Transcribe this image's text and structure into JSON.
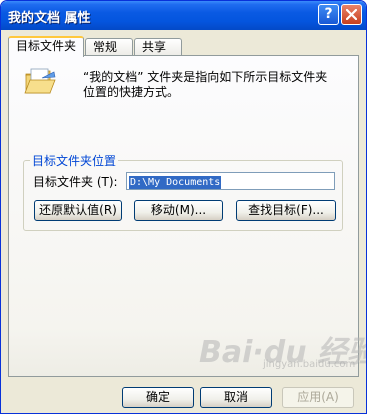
{
  "window": {
    "title": "我的文档  属性",
    "help_label": "?",
    "close_label": "×"
  },
  "tabs": [
    {
      "label": "目标文件夹"
    },
    {
      "label": "常规"
    },
    {
      "label": "共享"
    }
  ],
  "target_tab": {
    "description": "“我的文档” 文件夹是指向如下所示目标文件夹位置的快捷方式。",
    "group_title": "目标文件夹位置",
    "field_label": "目标文件夹 (T):",
    "field_value": "D:\\My Documents",
    "restore_button": "还原默认值(R)",
    "move_button": "移动(M)...",
    "find_button": "查找目标(F)..."
  },
  "footer": {
    "ok_button": "确定",
    "cancel_button": "取消",
    "apply_button": "应用(A)"
  },
  "watermark": {
    "text": "Bai·du 经验",
    "sub": "jingyan.baidu.com"
  },
  "colors": {
    "title_bar": "#0a5ae3",
    "dialog_bg": "#ece9d8",
    "group_title": "#0046d5",
    "selection": "#316ac5",
    "active_tab_accent": "#ffc83c"
  },
  "icons": [
    "folder-icon",
    "help-icon",
    "close-icon"
  ]
}
